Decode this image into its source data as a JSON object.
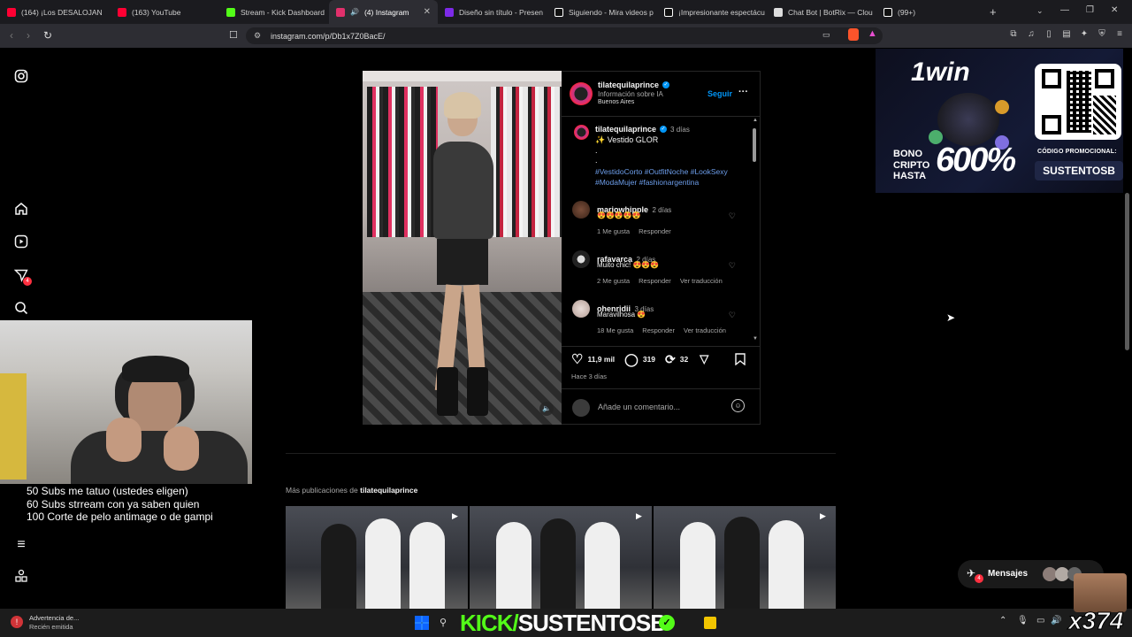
{
  "browser": {
    "tabs": [
      {
        "label": "(164) ¡Los DESALOJAN",
        "color": "#ff0033"
      },
      {
        "label": "(163) YouTube",
        "color": "#ff0033"
      },
      {
        "label": "Stream - Kick Dashboard",
        "color": "#53fc18"
      },
      {
        "label": "(4) Instagram",
        "color": "#e1306c",
        "active": true
      },
      {
        "label": "Diseño sin título - Presen",
        "color": "#7d2ae8"
      },
      {
        "label": "Siguiendo - Mira videos p",
        "color": "#ffffff"
      },
      {
        "label": "¡Impresionante espectácu",
        "color": "#ffffff"
      },
      {
        "label": "Chat Bot | BotRix — Clou",
        "color": "#ffffff"
      },
      {
        "label": "(99+)",
        "color": "#ffffff"
      }
    ],
    "url": "instagram.com/p/Db1x7Z0BacE/",
    "new_tab": "+"
  },
  "post": {
    "author": "tilatequilaprince",
    "subtitle": "Información sobre IA",
    "location": "Buenos Aires",
    "follow": "Seguir",
    "more": "···",
    "caption_user": "tilatequilaprince",
    "caption_time": "3 días",
    "caption_text": "✨ Vestido GLOR",
    "caption_dots": ".",
    "caption_dots2": ".",
    "hashtags_line1": "#VestidoCorto #OutfitNoche #LookSexy",
    "hashtags_line2": "#ModaMujer #fashionargentina",
    "comments": [
      {
        "user": "mariowhipple",
        "time": "2 días",
        "text": "😍😍😍😍😍",
        "likes": "1 Me gusta",
        "reply": "Responder",
        "translate": ""
      },
      {
        "user": "rafavarca",
        "time": "2 días",
        "text": "Muito chic! 😍😍😍",
        "likes": "2 Me gusta",
        "reply": "Responder",
        "translate": "Ver traducción"
      },
      {
        "user": "ohenridii",
        "time": "3 días",
        "text": "Maravilhosa 😍",
        "likes": "18 Me gusta",
        "reply": "Responder",
        "translate": "Ver traducción"
      }
    ],
    "likes_count": "11,9 mil",
    "comments_count": "319",
    "reposts_count": "32",
    "posted": "Hace 3 días",
    "add_comment": "Añade un comentario..."
  },
  "more_posts": {
    "label": "Más publicaciones de",
    "user": "tilatequilaprince"
  },
  "ad": {
    "brand": "1win",
    "bono_line1": "BONO",
    "bono_line2": "CRIPTO",
    "bono_line3": "HASTA",
    "percent": "600%",
    "promo_label": "CÓDIGO PROMOCIONAL:",
    "promo_code": "SUSTENTOSB"
  },
  "stream": {
    "subs_goals": [
      "50 Subs me tatuo (ustedes eligen)",
      "60 Subs strream con ya saben quien",
      "100 Corte de pelo antimage o de gampi"
    ],
    "banner_kick": "KICK/",
    "banner_name": "SUSTENTOSB",
    "counter": "x374"
  },
  "messages": {
    "label": "Mensajes",
    "badge": "4"
  },
  "notifications_badge": "4",
  "taskbar": {
    "warning_title": "Advertencia de...",
    "warning_sub": "Recién emitida"
  }
}
